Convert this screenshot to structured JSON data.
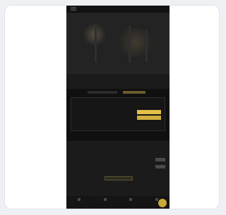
{
  "hero": {
    "title": "",
    "subtitle": ""
  },
  "section": {
    "label": "",
    "chips": [
      "",
      "",
      ""
    ]
  },
  "cookie": {
    "title": "",
    "body": "",
    "accept_label": "",
    "reject_label": "",
    "settings_label": ""
  },
  "list": {
    "title": "",
    "rows": [
      {
        "label": ""
      },
      {
        "label": ""
      }
    ]
  },
  "cta": {
    "label": ""
  },
  "nav": {
    "items": [
      {
        "label": ""
      },
      {
        "label": ""
      },
      {
        "label": ""
      },
      {
        "label": ""
      }
    ]
  },
  "colors": {
    "accent": "#e3c04a",
    "background": "#1b1b1b",
    "card": "#ffffff"
  }
}
